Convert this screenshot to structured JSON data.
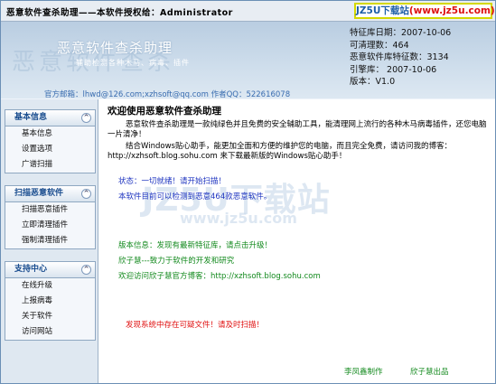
{
  "window": {
    "title": "恶意软件查杀助理——本软件授权给：Administrator"
  },
  "logo": {
    "brand": "JZ5U下载站",
    "url": "(www.jz5u.com)"
  },
  "header": {
    "app_title": "恶意软件查杀助理",
    "slogan": "辅助检测各种木马、病毒、插件",
    "contact": "官方邮箱：lhwd@126.com;xzhsoft@qq.com  作者QQ：522616078",
    "watermark": "恶意软件查杀"
  },
  "info": [
    "特征库日期：2007-10-06",
    "可清理数：464",
    "恶意软件库特征数：3134",
    "引擎库：  2007-10-06",
    "版本：V1.0"
  ],
  "sidebar": {
    "panels": [
      {
        "title": "基本信息",
        "items": [
          "基本信息",
          "设置选项",
          "广谱扫描"
        ]
      },
      {
        "title": "扫描恶意软件",
        "items": [
          "扫描恶意插件",
          "立即清理插件",
          "强制清理插件"
        ]
      },
      {
        "title": "支持中心",
        "items": [
          "在线升级",
          "上报病毒",
          "关于软件",
          "访问网站"
        ]
      }
    ],
    "collapse_glyph": "^"
  },
  "content": {
    "welcome": "欢迎使用恶意软件查杀助理",
    "para1": "恶意软件查杀助理是一款纯绿色并且免费的安全辅助工具，能清理网上流行的各种木马病毒插件，还您电脑一片清净！",
    "para2": "结合Windows贴心助手，能更加全面和方便的维护您的电脑，而且完全免费，请访问我的博客：http://xzhsoft.blog.sohu.com 来下载最新版的Windows贴心助手！",
    "status": "状态：一切就绪！请开始扫描！",
    "capability": "本软件目前可以检测到恶意464款恶意软件。",
    "version_info": "版本信息：发现有最新特征库，请点击升级！",
    "team": "欣子慧---致力于软件的开发和研究",
    "blog": "欢迎访问欣子慧官方博客：http://xzhsoft.blog.sohu.com",
    "warning": "发现系统中存在可疑文件！请及时扫描！",
    "author": "李凤鑫制作",
    "publisher": "欣子慧出品",
    "bg_watermark": "JZ5U下载站",
    "bg_watermark_url": "www.jz5u.com"
  }
}
